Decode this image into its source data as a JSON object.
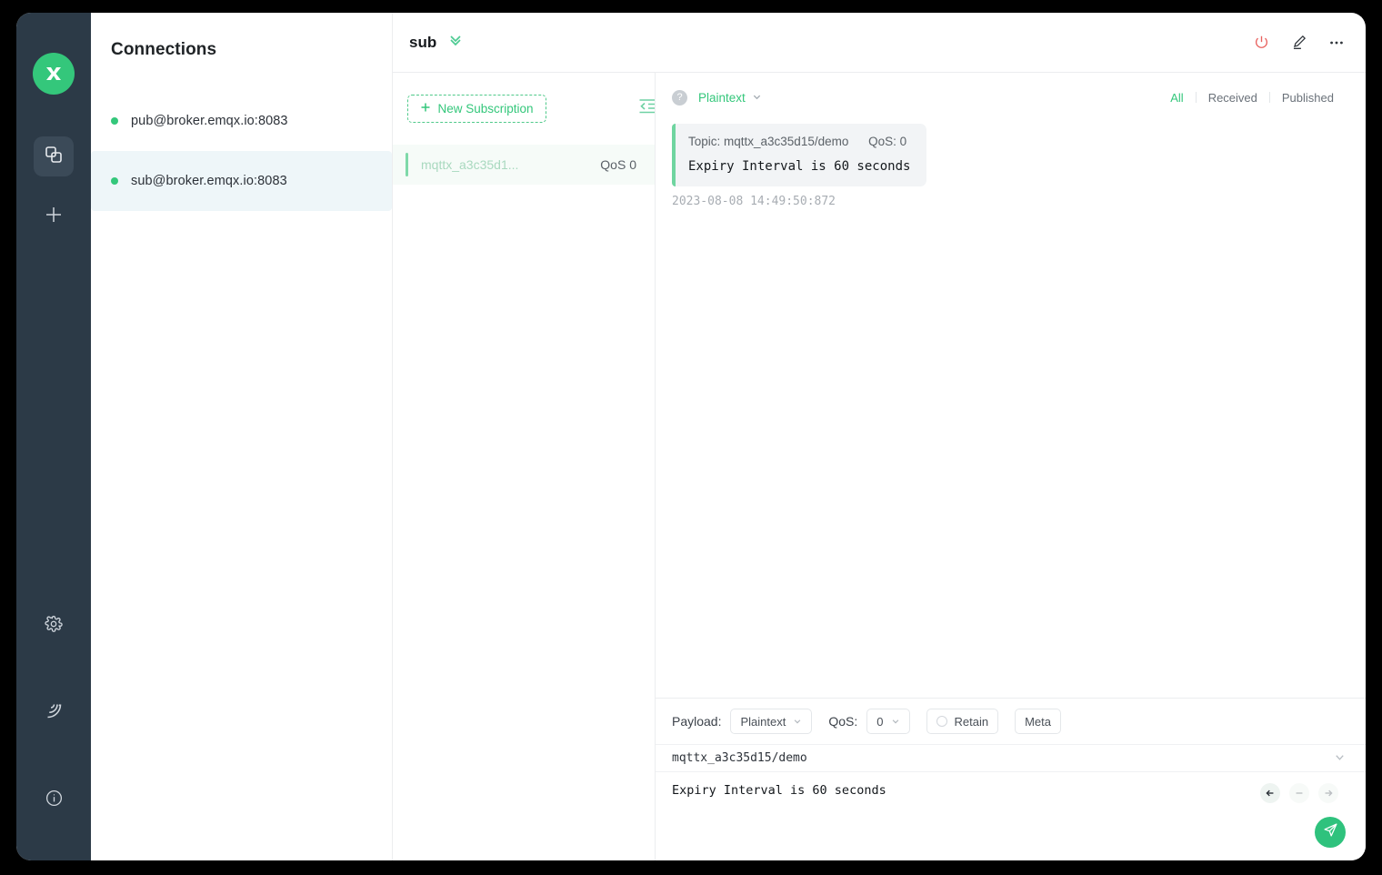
{
  "colors": {
    "accent_green": "#34c77b",
    "sidebar_dark": "#2c3a47",
    "selected_row": "#eef6f9",
    "danger_red": "#e8615e"
  },
  "rail": {
    "logo_name": "mqttx-logo",
    "items": [
      {
        "name": "connections-icon",
        "label": "Connections",
        "active": true
      },
      {
        "name": "new-connection-icon",
        "label": "New Connection",
        "active": false
      }
    ],
    "bottom_items": [
      {
        "name": "settings-icon",
        "label": "Settings"
      },
      {
        "name": "log-icon",
        "label": "Logs"
      },
      {
        "name": "about-icon",
        "label": "About"
      }
    ]
  },
  "connections": {
    "title": "Connections",
    "items": [
      {
        "label": "pub@broker.emqx.io:8083",
        "status": "connected",
        "selected": false
      },
      {
        "label": "sub@broker.emqx.io:8083",
        "status": "connected",
        "selected": true
      }
    ]
  },
  "header": {
    "title": "sub",
    "expand_icon": "double-chevron-down-icon",
    "actions": [
      {
        "name": "disconnect-icon",
        "label": "Disconnect"
      },
      {
        "name": "edit-icon",
        "label": "Edit Connection"
      },
      {
        "name": "more-options-icon",
        "label": "More"
      }
    ]
  },
  "subscriptions": {
    "new_button_label": "New Subscription",
    "new_button_icon": "plus-icon",
    "collapse_icon": "collapse-panel-icon",
    "items": [
      {
        "topic": "mqttx_a3c35d1...",
        "qos": "QoS 0"
      }
    ]
  },
  "messages_toolbar": {
    "help_icon": "question-mark-icon",
    "format": "Plaintext",
    "format_chevron": "chevron-down-icon",
    "filters": [
      {
        "label": "All",
        "active": true
      },
      {
        "label": "Received",
        "active": false
      },
      {
        "label": "Published",
        "active": false
      }
    ]
  },
  "messages": [
    {
      "topic_label": "Topic: mqttx_a3c35d15/demo",
      "qos_label": "QoS: 0",
      "payload": "Expiry Interval is 60 seconds",
      "time": "2023-08-08 14:49:50:872",
      "direction": "received"
    }
  ],
  "composer": {
    "payload_label": "Payload:",
    "payload_format": "Plaintext",
    "qos_label": "QoS:",
    "qos_value": "0",
    "retain_label": "Retain",
    "retain_checked": false,
    "meta_label": "Meta",
    "topic": "mqttx_a3c35d15/demo",
    "topic_chevron": "chevron-down-icon",
    "message": "Expiry Interval is 60 seconds",
    "nav_buttons": [
      {
        "name": "history-prev-icon",
        "enabled": true
      },
      {
        "name": "history-clear-icon",
        "enabled": false
      },
      {
        "name": "history-next-icon",
        "enabled": false
      }
    ],
    "send_icon": "send-icon"
  }
}
